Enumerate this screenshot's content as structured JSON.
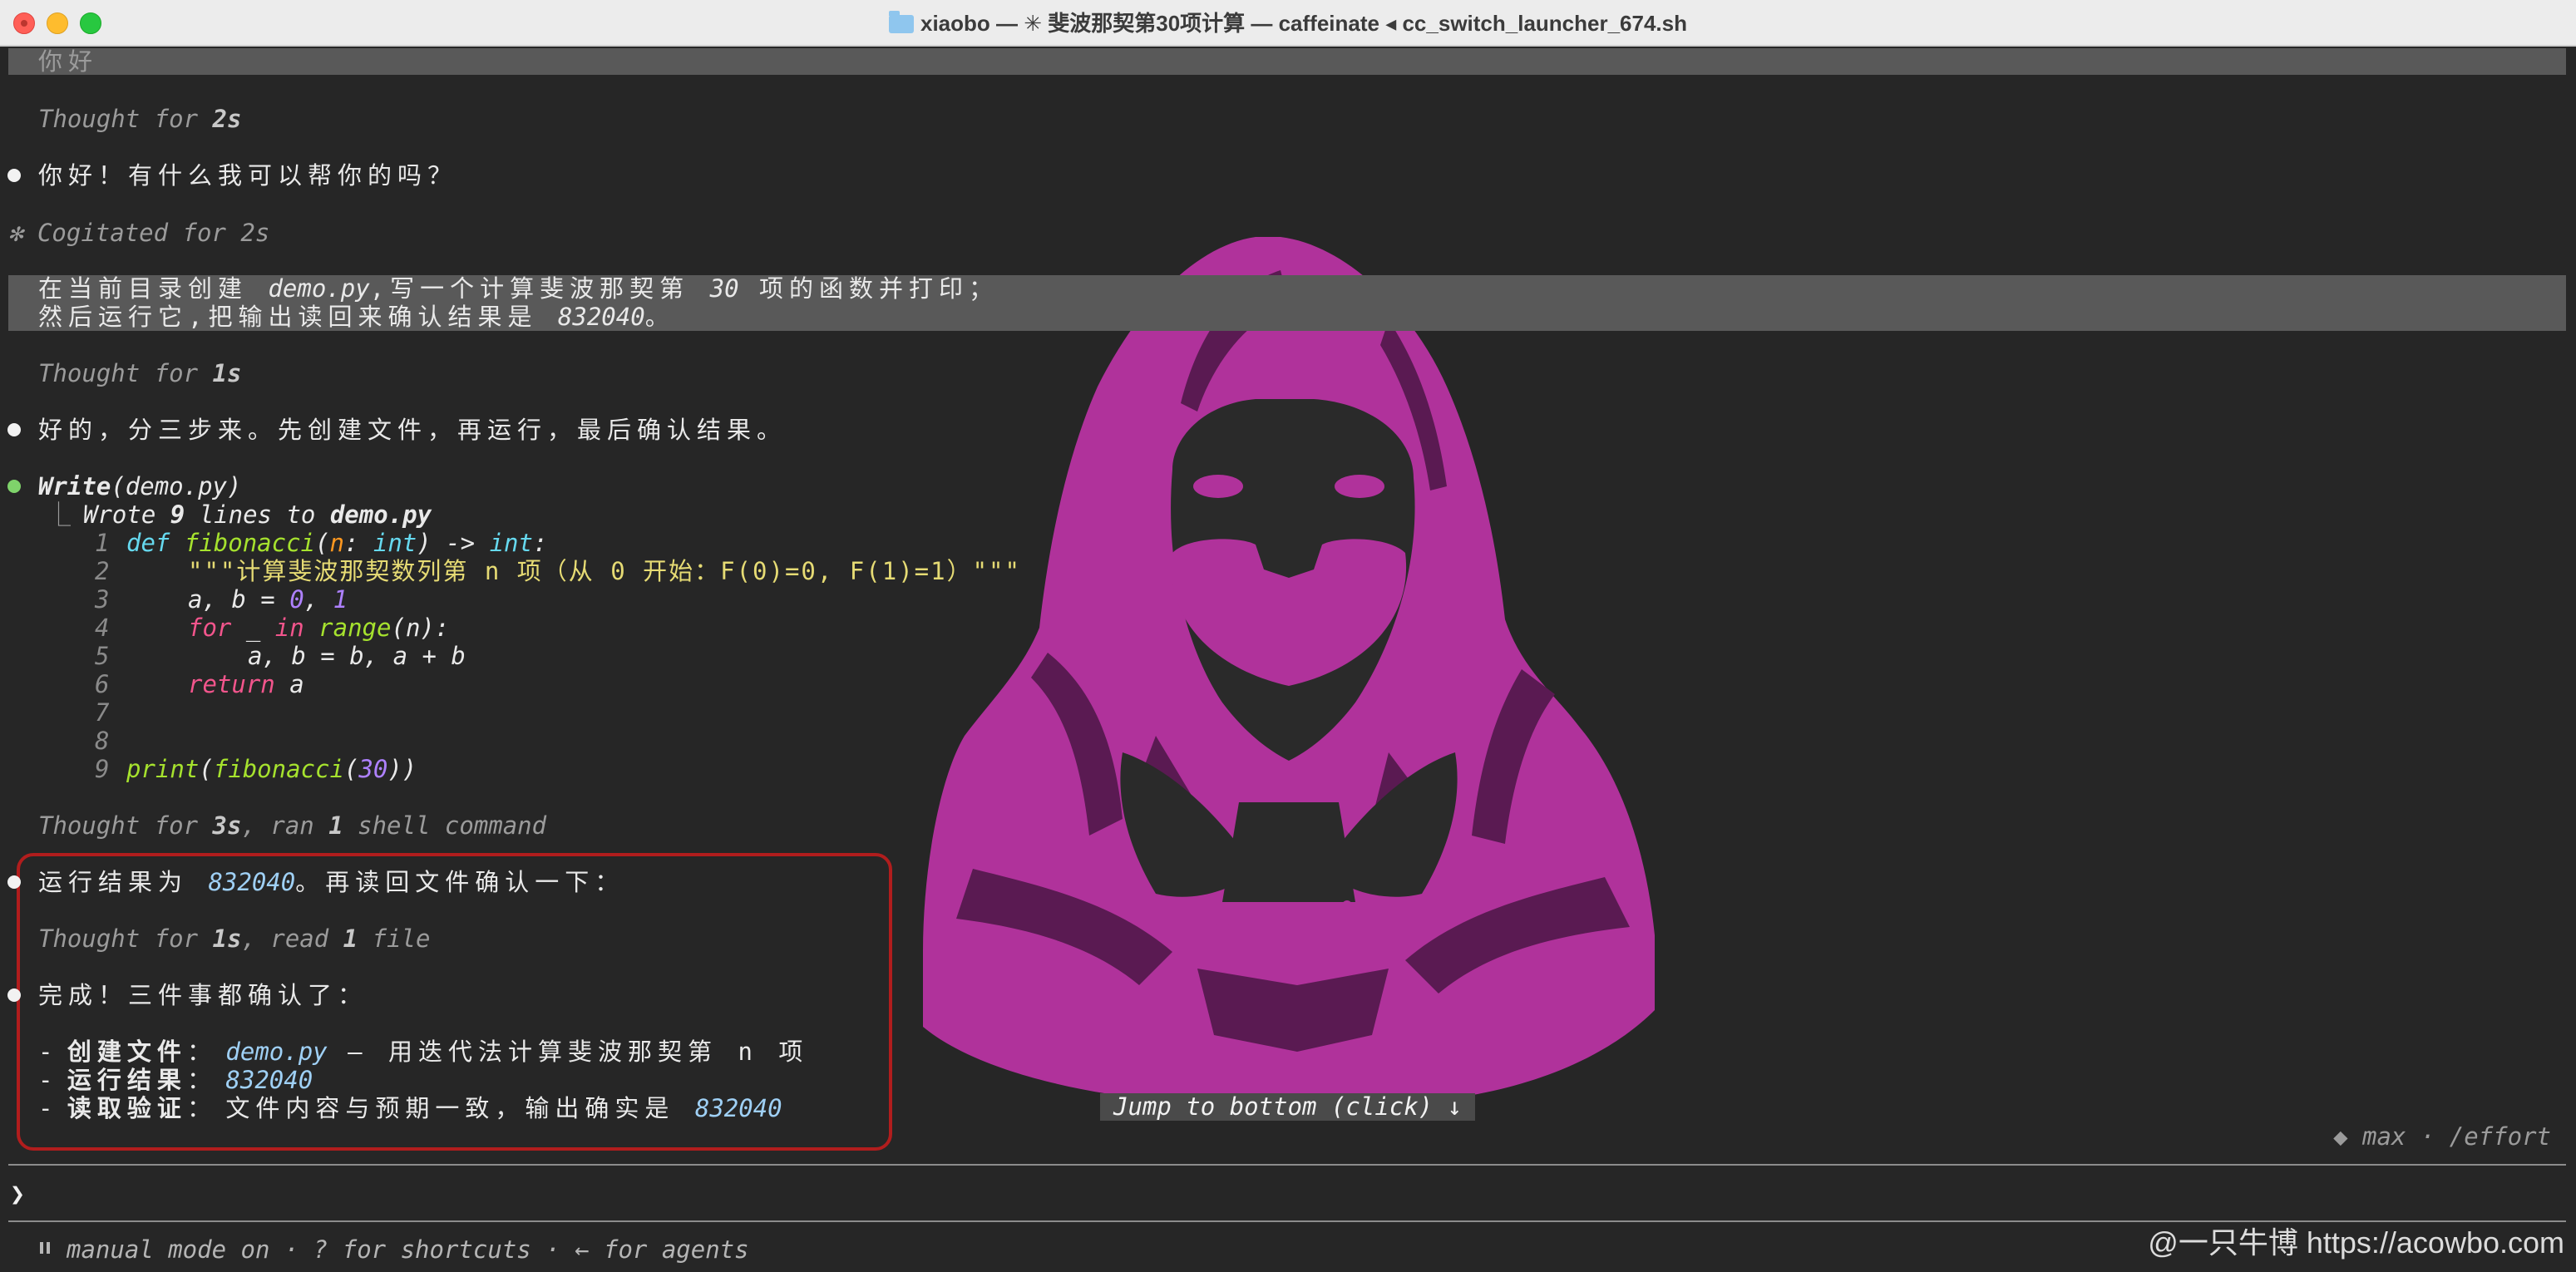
{
  "window": {
    "title": "xiaobo — ✳ 斐波那契第30项计算 — caffeinate ◂ cc_switch_launcher_674.sh"
  },
  "transcript": {
    "top_partial": "你好",
    "thought1": {
      "label": "Thought for ",
      "value": "2s"
    },
    "reply1": "你好！有什么我可以帮你的吗？",
    "cogitated": {
      "glyph": "✻",
      "label": "Cogitated for 2s"
    },
    "user_prompt": {
      "line1_a": "在当前目录创建 ",
      "line1_file": "demo.py",
      "line1_b": ",写一个计算斐波那契第 ",
      "line1_num": "30",
      "line1_c": " 项的函数并打印；",
      "line2_a": "然后运行它,把输出读回来确认结果是 ",
      "line2_num": "832040",
      "line2_b": "。"
    },
    "thought2": {
      "label": "Thought for ",
      "value": "1s"
    },
    "reply2": "好的，分三步来。先创建文件，再运行，最后确认结果。",
    "tool": {
      "name": "Write",
      "arg": "(demo.py)",
      "result_a": "Wrote ",
      "result_n": "9",
      "result_b": " lines to ",
      "result_file": "demo.py"
    },
    "code": {
      "line_numbers": [
        "1",
        "2",
        "3",
        "4",
        "5",
        "6",
        "7",
        "8",
        "9"
      ],
      "l1": {
        "def": "def",
        "fn": "fibonacci",
        "p1": "(",
        "arg": "n",
        "colon": ": ",
        "type": "int",
        "p2": ") -> ",
        "ret": "int",
        "end": ":"
      },
      "l2": "\"\"\"计算斐波那契数列第 n 项（从 0 开始：F(0)=0, F(1)=1）\"\"\"",
      "l3": {
        "a": "a, b = ",
        "n0": "0",
        "c": ", ",
        "n1": "1"
      },
      "l4": {
        "for": "for",
        "mid": " _ ",
        "in": "in",
        "sp": " ",
        "range": "range",
        "args": "(n):"
      },
      "l5": "a, b = b, a + b",
      "l6": {
        "ret": "return",
        "val": " a"
      },
      "l9": {
        "print": "print",
        "p1": "(",
        "fn": "fibonacci",
        "p2": "(",
        "num": "30",
        "end": "))"
      }
    },
    "thought3": {
      "label": "Thought for ",
      "v1": "3s",
      "mid": ", ran ",
      "v2": "1",
      "end": " shell command"
    },
    "reply3": {
      "a": "运行结果为 ",
      "num": "832040",
      "b": "。再读回文件确认一下："
    },
    "thought4": {
      "label": "Thought for ",
      "v1": "1s",
      "mid": ", read ",
      "v2": "1",
      "end": " file"
    },
    "reply4": "完成！三件事都确认了：",
    "summary": [
      {
        "dash": "- ",
        "label": "创建文件",
        "sep": "： ",
        "value": "demo.py",
        "rest": " — 用迭代法计算斐波那契第 n 项"
      },
      {
        "dash": "- ",
        "label": "运行结果",
        "sep": "： ",
        "value": "832040",
        "rest": ""
      },
      {
        "dash": "- ",
        "label": "读取验证",
        "sep": "： ",
        "value": "文件内容与预期一致，输出确实是 ",
        "rest": "832040"
      }
    ]
  },
  "jump_button": "Jump to bottom (click) ↓",
  "effort": "◆ max · /effort",
  "input": {
    "prompt_glyph": "❯",
    "value": ""
  },
  "footer": "manual mode on · ? for shortcuts · ← for agents",
  "watermark": "@一只牛博 https://acowbo.com",
  "colors": {
    "background": "#262626",
    "highlight": "#595959",
    "accent_box": "#b11d1d",
    "illustration": "#b0329b"
  }
}
